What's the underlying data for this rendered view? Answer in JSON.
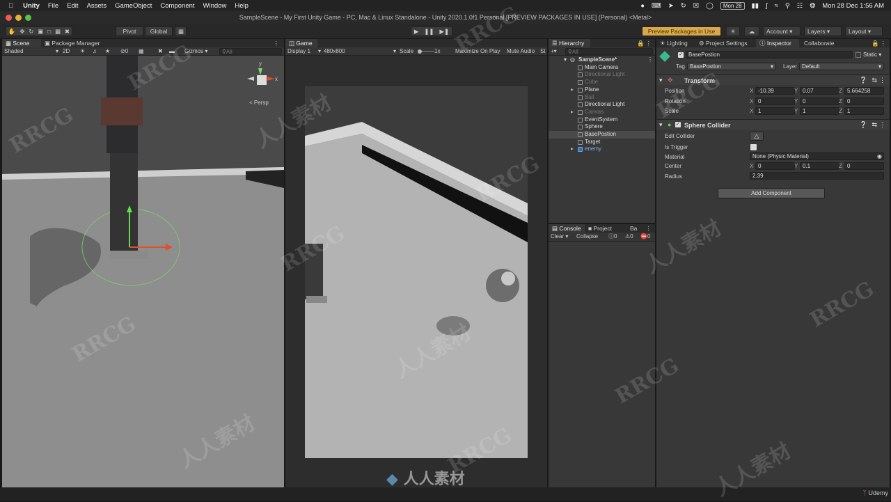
{
  "macbar": {
    "app": "Unity",
    "menus": [
      "File",
      "Edit",
      "Assets",
      "GameObject",
      "Component",
      "Window",
      "Help"
    ],
    "date_badge": "Mon 28",
    "clock": "Mon 28 Dec  1:56 AM"
  },
  "window_title": "SampleScene - My First Unity Game - PC, Mac & Linux Standalone - Unity 2020.1.0f1 Personal [PREVIEW PACKAGES IN USE] (Personal) <Metal>",
  "toolbar": {
    "pivot": "Pivot",
    "global": "Global",
    "preview_packages": "Preview Packages in Use",
    "account": "Account",
    "layers": "Layers",
    "layout": "Layout"
  },
  "scene_panel": {
    "tabs": [
      "Scene",
      "Package Manager"
    ],
    "shading": "Shaded",
    "mode2d": "2D",
    "fx_count": "0",
    "gizmos": "Gizmos",
    "search_placeholder": "All",
    "persp": "< Persp",
    "gizmo_y": "y",
    "gizmo_x": "x"
  },
  "game_panel": {
    "tab": "Game",
    "display": "Display 1",
    "resolution": "480x800",
    "scale_label": "Scale",
    "scale_value": "1x",
    "maximize": "Maximize On Play",
    "mute": "Mute Audio",
    "stats": "St"
  },
  "hierarchy": {
    "tab": "Hierarchy",
    "search_placeholder": "All",
    "scene": "SampleScene*",
    "items": [
      {
        "name": "Main Camera",
        "indent": 1,
        "dim": false,
        "arrow": false
      },
      {
        "name": "Directional Light",
        "indent": 1,
        "dim": true,
        "arrow": false
      },
      {
        "name": "Cube",
        "indent": 1,
        "dim": true,
        "arrow": false
      },
      {
        "name": "Plane",
        "indent": 1,
        "dim": false,
        "arrow": true
      },
      {
        "name": "Ball",
        "indent": 1,
        "dim": true,
        "arrow": false
      },
      {
        "name": "Directional Light",
        "indent": 1,
        "dim": false,
        "arrow": false
      },
      {
        "name": "Canvas",
        "indent": 1,
        "dim": true,
        "arrow": true
      },
      {
        "name": "EventSystem",
        "indent": 1,
        "dim": false,
        "arrow": false
      },
      {
        "name": "Sphere",
        "indent": 1,
        "dim": false,
        "arrow": false
      },
      {
        "name": "BasePostion",
        "indent": 1,
        "dim": false,
        "arrow": false,
        "selected": true
      },
      {
        "name": "Target",
        "indent": 1,
        "dim": false,
        "arrow": false
      },
      {
        "name": "enemy",
        "indent": 1,
        "dim": false,
        "arrow": true,
        "prefab": true
      }
    ]
  },
  "console": {
    "tabs": [
      "Console",
      "Project",
      "Ba"
    ],
    "clear": "Clear",
    "collapse": "Collapse",
    "info": "0",
    "warn": "0",
    "err": "0"
  },
  "inspector": {
    "tabs": [
      "Lighting",
      "Project Settings",
      "Inspector",
      "Collaborate"
    ],
    "object_name": "BasePostion",
    "static_label": "Static",
    "tag_label": "Tag",
    "tag_value": "BasePostion",
    "layer_label": "Layer",
    "layer_value": "Default",
    "transform": {
      "title": "Transform",
      "position_label": "Position",
      "rotation_label": "Rotation",
      "scale_label": "Scale",
      "position": [
        "-10.39",
        "0.07",
        "5.664258"
      ],
      "rotation": [
        "0",
        "0",
        "0"
      ],
      "scale": [
        "1",
        "1",
        "1"
      ]
    },
    "collider": {
      "title": "Sphere Collider",
      "edit_collider": "Edit Collider",
      "is_trigger": "Is Trigger",
      "material_label": "Material",
      "material_value": "None (Physic Material)",
      "center_label": "Center",
      "center": [
        "0",
        "0.1",
        "0"
      ],
      "radius_label": "Radius",
      "radius": "2.39"
    },
    "add_component": "Add Component"
  },
  "axis_labels": {
    "x": "X",
    "y": "Y",
    "z": "Z"
  },
  "watermarks": {
    "rrcg": "RRCG",
    "cn": "人人素材"
  },
  "udemy": "Udemy",
  "colors": {
    "selection": "#2c5d87",
    "accent_btn": "#d8a84a",
    "editor_bg": "#383838"
  }
}
